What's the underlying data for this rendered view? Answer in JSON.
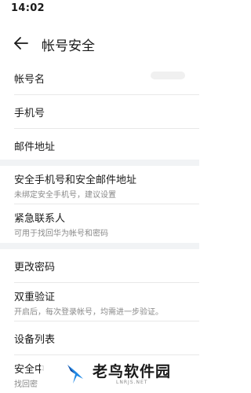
{
  "status_bar": {
    "time": "14:02"
  },
  "header": {
    "title": "帐号安全"
  },
  "sections": [
    {
      "items": [
        {
          "label": "帐号名"
        },
        {
          "label": "手机号"
        },
        {
          "label": "邮件地址"
        }
      ]
    },
    {
      "items": [
        {
          "label": "安全手机号和安全邮件地址",
          "subtitle": "未绑定安全手机号，建议设置"
        },
        {
          "label": "紧急联系人",
          "subtitle": "可用于找回华为帐号和密码"
        }
      ]
    },
    {
      "items": [
        {
          "label": "更改密码"
        },
        {
          "label": "双重验证",
          "subtitle": "开启后，每次登录帐号，均需进一步验证。"
        },
        {
          "label": "设备列表"
        },
        {
          "label": "安全中",
          "subtitle": "找回密"
        }
      ]
    }
  ],
  "watermark": {
    "text": "老鸟软件园",
    "site": "LNRJS.NET"
  },
  "colors": {
    "divider": "#e8e8e8",
    "section_gap": "#f1f3f5",
    "secondary_text": "#8a8a8a",
    "logo_blue": "#1e88e5"
  }
}
